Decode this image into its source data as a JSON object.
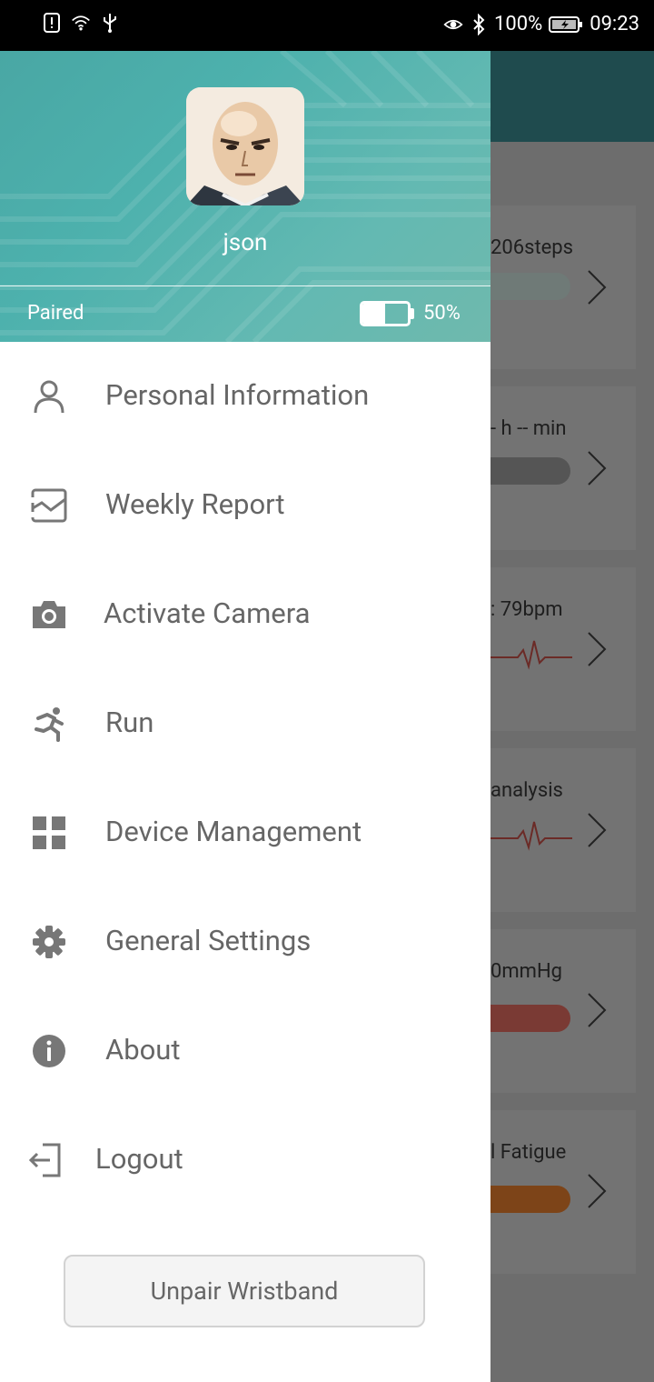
{
  "status_bar": {
    "battery_text": "100%",
    "time": "09:23",
    "left_icons": [
      "notification-icon",
      "wifi-icon",
      "usb-icon"
    ],
    "right_icons": [
      "eye-comfort-icon",
      "bluetooth-icon",
      "battery-charging-icon"
    ]
  },
  "drawer": {
    "username": "json",
    "pair_status": "Paired",
    "device_battery_text": "50%",
    "device_battery_level": 0.5,
    "menu": [
      {
        "label": "Personal Information",
        "icon": "person-icon"
      },
      {
        "label": "Weekly Report",
        "icon": "report-chart-icon"
      },
      {
        "label": "Activate Camera",
        "icon": "camera-icon"
      },
      {
        "label": "Run",
        "icon": "running-icon"
      },
      {
        "label": "Device Management",
        "icon": "grid-icon"
      },
      {
        "label": "General Settings",
        "icon": "gear-icon"
      },
      {
        "label": "About",
        "icon": "info-icon"
      },
      {
        "label": "Logout",
        "icon": "logout-icon"
      }
    ],
    "unpair_label": "Unpair Wristband"
  },
  "background": {
    "cards": [
      {
        "text": "206steps",
        "bar_color": "#6f7a77"
      },
      {
        "text": "- h -- min",
        "bar_color": "#555555"
      },
      {
        "text": ": 79bpm",
        "bar_color": null
      },
      {
        "text": "analysis",
        "bar_color": null
      },
      {
        "text": "0mmHg",
        "bar_color": "#7a3a34"
      },
      {
        "text": "l Fatigue",
        "bar_color": "#7d4418"
      }
    ]
  },
  "colors": {
    "header_teal": "#4db1ad",
    "menu_text": "#666666",
    "icon_gray": "#777777"
  }
}
